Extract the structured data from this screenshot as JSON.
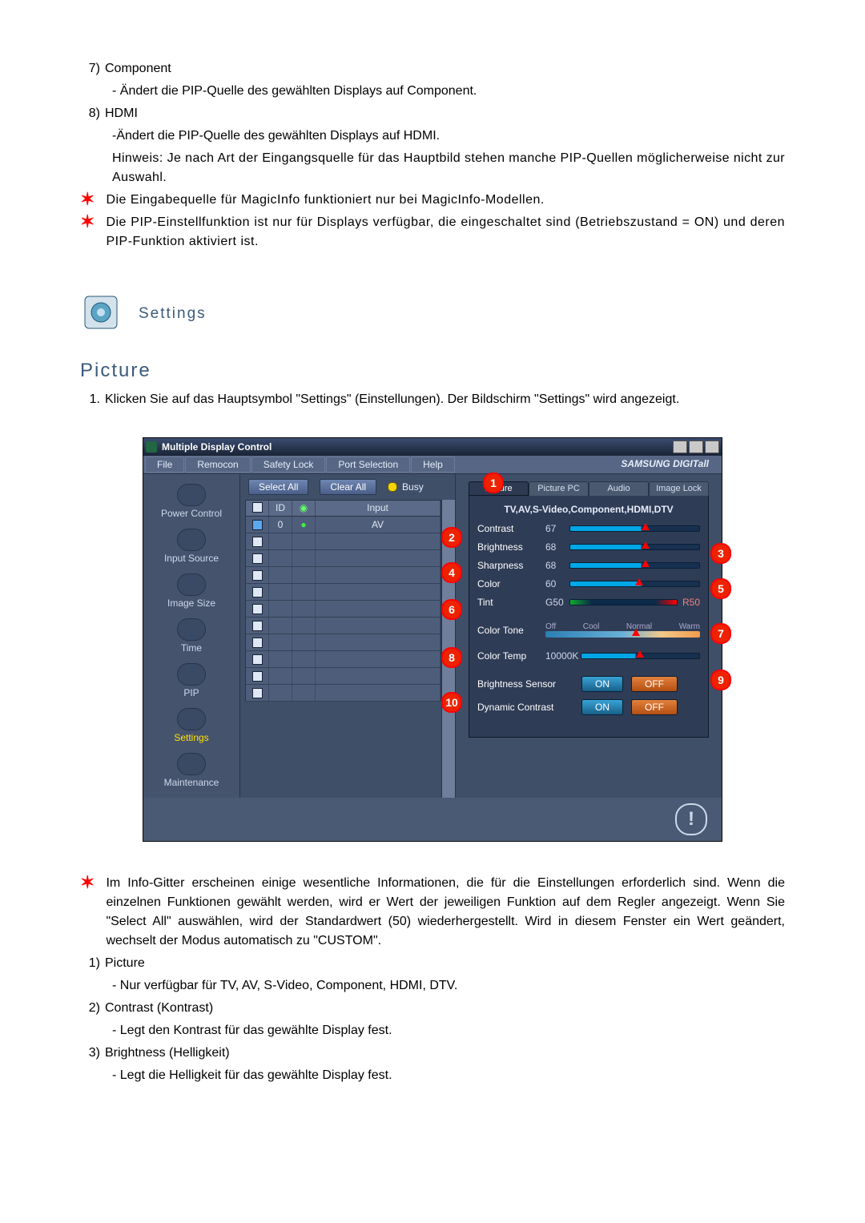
{
  "top": {
    "i7_num": "7)",
    "i7_label": "Component",
    "i7_desc": "- Ändert die PIP-Quelle des gewählten Displays auf Component.",
    "i8_num": "8)",
    "i8_label": "HDMI",
    "i8_desc": "-Ändert die PIP-Quelle des gewählten Displays auf HDMI.",
    "i8_hint": "Hinweis: Je nach Art der Eingangsquelle für das Hauptbild stehen manche PIP-Quellen möglicherweise nicht zur Auswahl.",
    "note1": "Die Eingabequelle für MagicInfo funktioniert nur bei MagicInfo-Modellen.",
    "note2": "Die PIP-Einstellfunktion ist nur für Displays verfügbar, die eingeschaltet sind (Betriebszustand = ON) und deren PIP-Funktion aktiviert ist."
  },
  "settings_title": "Settings",
  "section": "Picture",
  "intro_num": "1.",
  "intro": "Klicken Sie auf das Hauptsymbol \"Settings\" (Einstellungen). Der Bildschirm \"Settings\" wird angezeigt.",
  "app": {
    "title": "Multiple Display Control",
    "menu": [
      "File",
      "Remocon",
      "Safety Lock",
      "Port Selection",
      "Help"
    ],
    "brand": "SAMSUNG DIGITall",
    "sidebar": [
      "Power Control",
      "Input Source",
      "Image Size",
      "Time",
      "PIP",
      "Settings",
      "Maintenance"
    ],
    "select_all": "Select All",
    "clear_all": "Clear All",
    "busy": "Busy",
    "cols": {
      "id": "ID",
      "input": "Input"
    },
    "row": {
      "id": "0",
      "input": "AV"
    },
    "tabs": [
      "Picture",
      "Picture PC",
      "Audio",
      "Image Lock"
    ],
    "tab_sub": "TV,AV,S-Video,Component,HDMI,DTV",
    "sliders": {
      "contrast": {
        "l": "Contrast",
        "v": "67"
      },
      "brightness": {
        "l": "Brightness",
        "v": "68"
      },
      "sharpness": {
        "l": "Sharpness",
        "v": "68"
      },
      "color": {
        "l": "Color",
        "v": "60"
      },
      "tint": {
        "l": "Tint",
        "g": "G50",
        "r": "R50"
      },
      "tone": {
        "l": "Color Tone",
        "off": "Off",
        "cool": "Cool",
        "normal": "Normal",
        "warm": "Warm"
      },
      "temp": {
        "l": "Color Temp",
        "v": "10000K"
      }
    },
    "bsensor": "Brightness Sensor",
    "dcontrast": "Dynamic Contrast",
    "on": "ON",
    "off": "OFF"
  },
  "callouts": [
    "1",
    "2",
    "3",
    "4",
    "5",
    "6",
    "7",
    "8",
    "9",
    "10"
  ],
  "note3": "Im Info-Gitter erscheinen einige wesentliche Informationen, die für die Einstellungen erforderlich sind. Wenn die einzelnen Funktionen gewählt werden, wird er Wert der jeweiligen Funktion auf dem Regler angezeigt. Wenn Sie \"Select All\" auswählen, wird der Standardwert (50) wiederhergestellt. Wird in diesem Fenster ein Wert geändert, wechselt der Modus automatisch zu \"CUSTOM\".",
  "list": {
    "n1": "1)",
    "t1": "Picture",
    "d1": "- Nur verfügbar für TV, AV, S-Video, Component, HDMI, DTV.",
    "n2": "2)",
    "t2": "Contrast (Kontrast)",
    "d2": "- Legt den Kontrast für das gewählte Display fest.",
    "n3": "3)",
    "t3": "Brightness (Helligkeit)",
    "d3": "- Legt die Helligkeit für das gewählte Display fest."
  }
}
